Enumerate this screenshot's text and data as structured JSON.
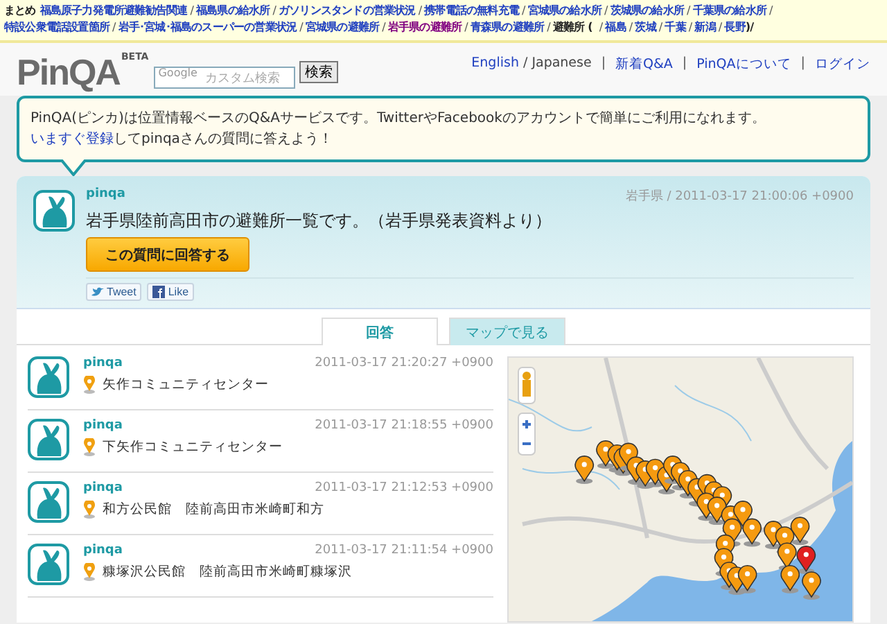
{
  "topnav": [
    {
      "kind": "plain",
      "text": "まとめ"
    },
    {
      "kind": "link",
      "text": "福島原子力発電所避難勧告関連"
    },
    {
      "kind": "sep",
      "text": "/"
    },
    {
      "kind": "link",
      "text": "福島県の給水所"
    },
    {
      "kind": "sep",
      "text": "/"
    },
    {
      "kind": "link",
      "text": "ガソリンスタンドの営業状況"
    },
    {
      "kind": "sep",
      "text": "/"
    },
    {
      "kind": "link",
      "text": "携帯電話の無料充電"
    },
    {
      "kind": "sep",
      "text": "/"
    },
    {
      "kind": "link",
      "text": "宮城県の給水所"
    },
    {
      "kind": "sep",
      "text": "/"
    },
    {
      "kind": "link",
      "text": "茨城県の給水所"
    },
    {
      "kind": "sep",
      "text": "/"
    },
    {
      "kind": "link",
      "text": "千葉県の給水所"
    },
    {
      "kind": "sep",
      "text": "/"
    },
    {
      "kind": "link",
      "text": "特設公衆電話設置箇所"
    },
    {
      "kind": "sep",
      "text": "/"
    },
    {
      "kind": "link",
      "text": "岩手･宮城･福島のスーパーの営業状況"
    },
    {
      "kind": "sep",
      "text": "/"
    },
    {
      "kind": "link",
      "text": "宮城県の避難所"
    },
    {
      "kind": "sep",
      "text": "/"
    },
    {
      "kind": "visited",
      "text": "岩手県の避難所"
    },
    {
      "kind": "sep",
      "text": "/"
    },
    {
      "kind": "link",
      "text": "青森県の避難所"
    },
    {
      "kind": "sep",
      "text": "/"
    },
    {
      "kind": "plain",
      "text": "避難所 ("
    },
    {
      "kind": "sep",
      "text": "/"
    },
    {
      "kind": "link",
      "text": "福島"
    },
    {
      "kind": "sep",
      "text": "/"
    },
    {
      "kind": "link",
      "text": "茨城"
    },
    {
      "kind": "sep",
      "text": "/"
    },
    {
      "kind": "link",
      "text": "千葉"
    },
    {
      "kind": "sep",
      "text": "/"
    },
    {
      "kind": "link",
      "text": "新潟"
    },
    {
      "kind": "sep",
      "text": "/"
    },
    {
      "kind": "link",
      "text": "長野"
    },
    {
      "kind": "plain",
      "text": ")/"
    }
  ],
  "logo": {
    "text": "PinQA",
    "badge": "BETA"
  },
  "search": {
    "placeholder": "カスタム検索",
    "brand": "Google",
    "button": "検索"
  },
  "header_links": [
    {
      "kind": "link",
      "text": "English"
    },
    {
      "kind": "plain",
      "text": "/ Japanese"
    },
    {
      "kind": "sep",
      "text": "|"
    },
    {
      "kind": "link",
      "text": "新着Q&A"
    },
    {
      "kind": "sep",
      "text": "|"
    },
    {
      "kind": "link",
      "text": "PinQAについて"
    },
    {
      "kind": "sep",
      "text": "|"
    },
    {
      "kind": "link",
      "text": "ログイン"
    }
  ],
  "intro": {
    "line1": "PinQA(ピンカ)は位置情報ベースのQ&Aサービスです。TwitterやFacebookのアカウントで簡単にご利用になれます。",
    "link": "いますぐ登録",
    "rest": "してpinqaさんの質問に答えよう！"
  },
  "question": {
    "user": "pinqa",
    "meta": "岩手県 / 2011-03-17 21:00:06 +0900",
    "text": "岩手県陸前高田市の避難所一覧です。（岩手県発表資料より）",
    "answer_button": "この質問に回答する",
    "tweet": "Tweet",
    "like": "Like"
  },
  "tabs": [
    {
      "label": "回答",
      "selected": true
    },
    {
      "label": "マップで見る",
      "selected": false
    }
  ],
  "answers": [
    {
      "user": "pinqa",
      "time": "2011-03-17 21:20:27 +0900",
      "place": "矢作コミュニティセンター"
    },
    {
      "user": "pinqa",
      "time": "2011-03-17 21:18:55 +0900",
      "place": "下矢作コミュニティセンター"
    },
    {
      "user": "pinqa",
      "time": "2011-03-17 21:12:53 +0900",
      "place": "和方公民館　陸前高田市米崎町和方"
    },
    {
      "user": "pinqa",
      "time": "2011-03-17 21:11:54 +0900",
      "place": "糠塚沢公民館　陸前高田市米崎町糠塚沢"
    }
  ]
}
